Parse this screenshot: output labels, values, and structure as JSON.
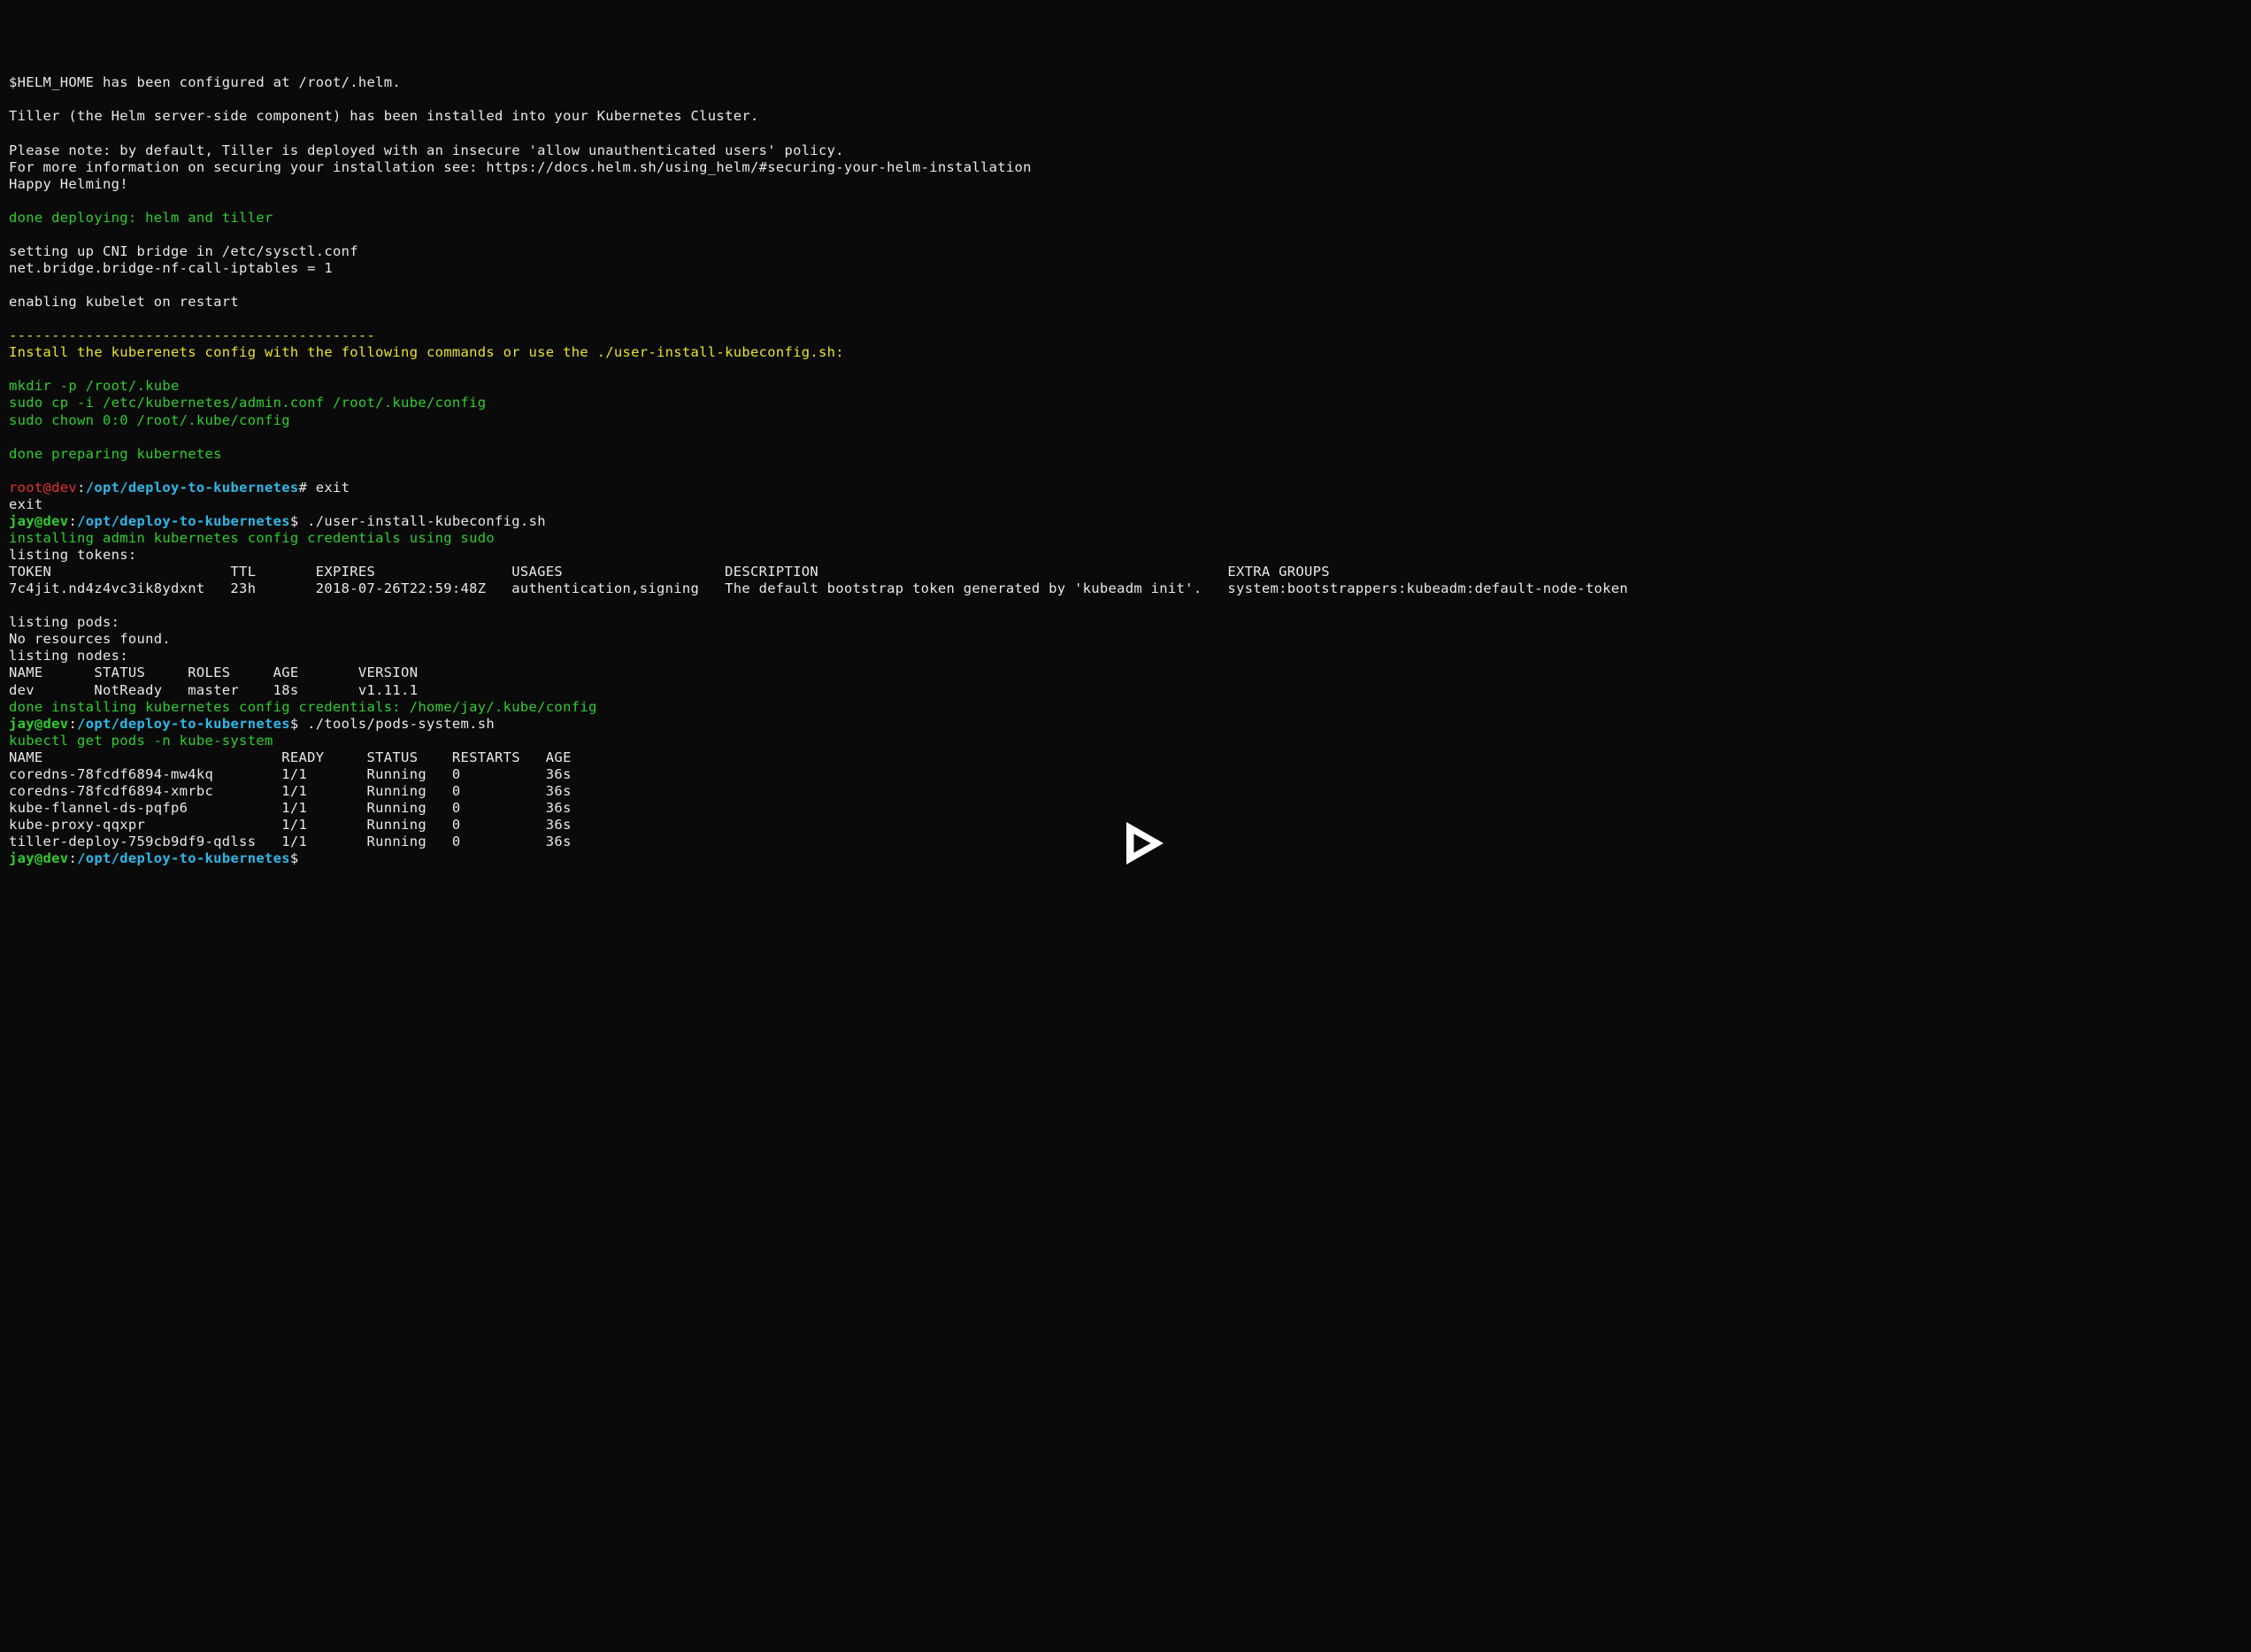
{
  "lines": [
    {
      "segments": [
        {
          "text": "$HELM_HOME has been configured at /root/.helm.",
          "cls": "white"
        }
      ]
    },
    {
      "segments": []
    },
    {
      "segments": [
        {
          "text": "Tiller (the Helm server-side component) has been installed into your Kubernetes Cluster.",
          "cls": "white"
        }
      ]
    },
    {
      "segments": []
    },
    {
      "segments": [
        {
          "text": "Please note: by default, Tiller is deployed with an insecure 'allow unauthenticated users' policy.",
          "cls": "white"
        }
      ]
    },
    {
      "segments": [
        {
          "text": "For more information on securing your installation see: https://docs.helm.sh/using_helm/#securing-your-helm-installation",
          "cls": "white"
        }
      ]
    },
    {
      "segments": [
        {
          "text": "Happy Helming!",
          "cls": "white"
        }
      ]
    },
    {
      "segments": []
    },
    {
      "segments": [
        {
          "text": "done deploying: helm and tiller",
          "cls": "green"
        }
      ]
    },
    {
      "segments": []
    },
    {
      "segments": [
        {
          "text": "setting up CNI bridge in /etc/sysctl.conf",
          "cls": "white"
        }
      ]
    },
    {
      "segments": [
        {
          "text": "net.bridge.bridge-nf-call-iptables = 1",
          "cls": "white"
        }
      ]
    },
    {
      "segments": []
    },
    {
      "segments": [
        {
          "text": "enabling kubelet on restart",
          "cls": "white"
        }
      ]
    },
    {
      "segments": []
    },
    {
      "segments": [
        {
          "text": "-------------------------------------------",
          "cls": "yellow"
        }
      ]
    },
    {
      "segments": [
        {
          "text": "Install the kuberenets config with the following commands or use the ./user-install-kubeconfig.sh:",
          "cls": "yellow"
        }
      ]
    },
    {
      "segments": []
    },
    {
      "segments": [
        {
          "text": "mkdir -p /root/.kube",
          "cls": "green"
        }
      ]
    },
    {
      "segments": [
        {
          "text": "sudo cp -i /etc/kubernetes/admin.conf /root/.kube/config",
          "cls": "green"
        }
      ]
    },
    {
      "segments": [
        {
          "text": "sudo chown 0:0 /root/.kube/config",
          "cls": "green"
        }
      ]
    },
    {
      "segments": []
    },
    {
      "segments": [
        {
          "text": "done preparing kubernetes",
          "cls": "green"
        }
      ]
    },
    {
      "segments": []
    },
    {
      "segments": [
        {
          "text": "root@dev",
          "cls": "red"
        },
        {
          "text": ":",
          "cls": "white"
        },
        {
          "text": "/opt/deploy-to-kubernetes",
          "cls": "cyan-bold"
        },
        {
          "text": "# exit",
          "cls": "white"
        }
      ]
    },
    {
      "segments": [
        {
          "text": "exit",
          "cls": "white"
        }
      ]
    },
    {
      "segments": [
        {
          "text": "jay@dev",
          "cls": "green-bold"
        },
        {
          "text": ":",
          "cls": "white"
        },
        {
          "text": "/opt/deploy-to-kubernetes",
          "cls": "cyan-bold"
        },
        {
          "text": "$ ./user-install-kubeconfig.sh",
          "cls": "white"
        }
      ]
    },
    {
      "segments": [
        {
          "text": "installing admin kubernetes config credentials using sudo",
          "cls": "green"
        }
      ]
    },
    {
      "segments": [
        {
          "text": "listing tokens:",
          "cls": "white"
        }
      ]
    },
    {
      "segments": [
        {
          "text": "TOKEN                     TTL       EXPIRES                USAGES                   DESCRIPTION                                                EXTRA GROUPS",
          "cls": "white"
        }
      ]
    },
    {
      "segments": [
        {
          "text": "7c4jit.nd4z4vc3ik8ydxnt   23h       2018-07-26T22:59:48Z   authentication,signing   The default bootstrap token generated by 'kubeadm init'.   system:bootstrappers:kubeadm:default-node-token",
          "cls": "white"
        }
      ]
    },
    {
      "segments": []
    },
    {
      "segments": [
        {
          "text": "listing pods:",
          "cls": "white"
        }
      ]
    },
    {
      "segments": [
        {
          "text": "No resources found.",
          "cls": "white"
        }
      ]
    },
    {
      "segments": [
        {
          "text": "listing nodes:",
          "cls": "white"
        }
      ]
    },
    {
      "segments": [
        {
          "text": "NAME      STATUS     ROLES     AGE       VERSION",
          "cls": "white"
        }
      ]
    },
    {
      "segments": [
        {
          "text": "dev       NotReady   master    18s       v1.11.1",
          "cls": "white"
        }
      ]
    },
    {
      "segments": [
        {
          "text": "done installing kubernetes config credentials: /home/jay/.kube/config",
          "cls": "green"
        }
      ]
    },
    {
      "segments": [
        {
          "text": "jay@dev",
          "cls": "green-bold"
        },
        {
          "text": ":",
          "cls": "white"
        },
        {
          "text": "/opt/deploy-to-kubernetes",
          "cls": "cyan-bold"
        },
        {
          "text": "$ ./tools/pods-system.sh",
          "cls": "white"
        }
      ]
    },
    {
      "segments": [
        {
          "text": "kubectl get pods -n kube-system",
          "cls": "green"
        }
      ]
    },
    {
      "segments": [
        {
          "text": "NAME                            READY     STATUS    RESTARTS   AGE",
          "cls": "white"
        }
      ]
    },
    {
      "segments": [
        {
          "text": "coredns-78fcdf6894-mw4kq        1/1       Running   0          36s",
          "cls": "white"
        }
      ]
    },
    {
      "segments": [
        {
          "text": "coredns-78fcdf6894-xmrbc        1/1       Running   0          36s",
          "cls": "white"
        }
      ]
    },
    {
      "segments": [
        {
          "text": "kube-flannel-ds-pqfp6           1/1       Running   0          36s",
          "cls": "white"
        }
      ]
    },
    {
      "segments": [
        {
          "text": "kube-proxy-qqxpr                1/1       Running   0          36s",
          "cls": "white"
        }
      ]
    },
    {
      "segments": [
        {
          "text": "tiller-deploy-759cb9df9-qdlss   1/1       Running   0          36s",
          "cls": "white"
        }
      ]
    },
    {
      "segments": [
        {
          "text": "jay@dev",
          "cls": "green-bold"
        },
        {
          "text": ":",
          "cls": "white"
        },
        {
          "text": "/opt/deploy-to-kubernetes",
          "cls": "cyan-bold"
        },
        {
          "text": "$ ",
          "cls": "white"
        }
      ]
    }
  ]
}
